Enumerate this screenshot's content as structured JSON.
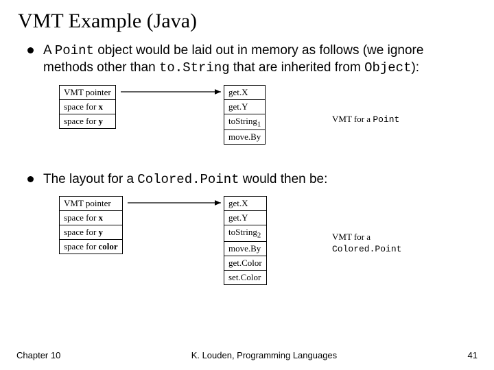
{
  "title": "VMT Example (Java)",
  "bullets": {
    "b1_pre": "A ",
    "b1_code1": "Point",
    "b1_mid": " object would be laid out in memory as follows (we ignore methods other than ",
    "b1_code2": "to.String",
    "b1_post": " that are inherited from ",
    "b1_code3": "Object",
    "b1_end": "):",
    "b2_pre": "The layout for a ",
    "b2_code": "Colored.Point",
    "b2_post": " would then be:"
  },
  "point_obj": {
    "r0": "VMT pointer",
    "r1_a": "space for ",
    "r1_b": "x",
    "r2_a": "space for ",
    "r2_b": "y"
  },
  "point_vmt": {
    "r0": "get.X",
    "r1": "get.Y",
    "r2": "toString",
    "r2_sub": "1",
    "r3": "move.By"
  },
  "point_caption_a": "VMT for a ",
  "point_caption_b": "Point",
  "cp_obj": {
    "r0": "VMT pointer",
    "r1_a": "space for ",
    "r1_b": "x",
    "r2_a": "space for ",
    "r2_b": "y",
    "r3_a": "space for ",
    "r3_b": "color"
  },
  "cp_vmt": {
    "r0": "get.X",
    "r1": "get.Y",
    "r2": "toString",
    "r2_sub": "2",
    "r3": "move.By",
    "r4": "get.Color",
    "r5": "set.Color"
  },
  "cp_caption_a": "VMT for a",
  "cp_caption_b": "Colored.Point",
  "footer": {
    "left": "Chapter 10",
    "center": "K. Louden, Programming Languages",
    "right": "41"
  }
}
